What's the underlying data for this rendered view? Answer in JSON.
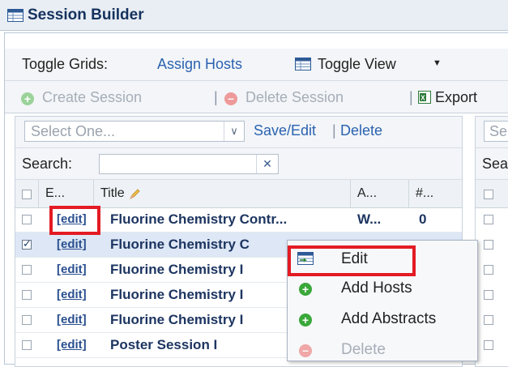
{
  "window": {
    "title": "Session Builder"
  },
  "toolbar": {
    "toggle_grids_label": "Toggle Grids:",
    "assign_hosts": "Assign Hosts",
    "toggle_view": "Toggle View",
    "create_session": "Create Session",
    "delete_session": "Delete Session",
    "export": "Export",
    "sep": "|"
  },
  "left_panel": {
    "select_placeholder": "Select One...",
    "save_edit": "Save/Edit",
    "delete": "Delete",
    "search_label": "Search:",
    "search_value": "",
    "columns": [
      "E...",
      "Title",
      "A...",
      "#..."
    ],
    "rows": [
      {
        "edit": "[edit]",
        "title": "Fluorine Chemistry Contr...",
        "a": "W...",
        "n": "0",
        "checked": false
      },
      {
        "edit": "[edit]",
        "title": "Fluorine Chemistry C",
        "checked": true
      },
      {
        "edit": "[edit]",
        "title": "Fluorine Chemistry I",
        "checked": false
      },
      {
        "edit": "[edit]",
        "title": "Fluorine Chemistry I",
        "checked": false
      },
      {
        "edit": "[edit]",
        "title": "Fluorine Chemistry I",
        "checked": false
      },
      {
        "edit": "[edit]",
        "title": "Poster Session I",
        "checked": false
      }
    ]
  },
  "right_panel": {
    "select_fragment": "Se",
    "search_fragment": "Sea"
  },
  "context_menu": {
    "items": [
      {
        "label": "Edit",
        "icon": "edit-icon",
        "enabled": true
      },
      {
        "label": "Add Hosts",
        "icon": "add-icon",
        "enabled": true
      },
      {
        "label": "Add Abstracts",
        "icon": "add-icon",
        "enabled": true
      },
      {
        "label": "Delete",
        "icon": "remove-icon",
        "enabled": false
      }
    ]
  },
  "colors": {
    "highlight": "#e31b23",
    "link": "#2a62b0",
    "title_text": "#15325e"
  }
}
